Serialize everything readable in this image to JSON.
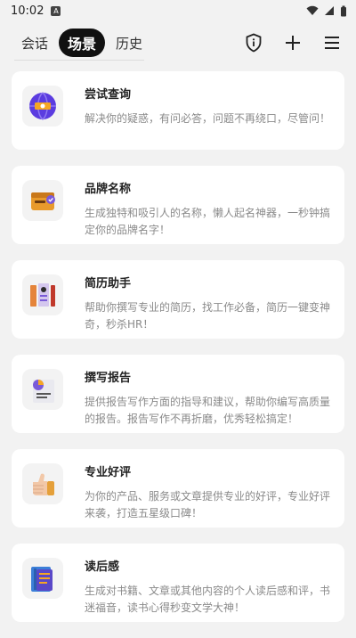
{
  "status": {
    "time": "10:02",
    "notif_letter": "A"
  },
  "tabs": [
    {
      "label": "会话",
      "active": false
    },
    {
      "label": "场景",
      "active": true
    },
    {
      "label": "历史",
      "active": false
    }
  ],
  "header_icons": [
    "shield-info-icon",
    "plus-icon",
    "menu-icon"
  ],
  "cards": [
    {
      "title": "尝试查询",
      "desc": "解决你的疑惑，有问必答，问题不再绕口，尽管问！",
      "icon": "globe-query-icon"
    },
    {
      "title": "品牌名称",
      "desc": "生成独特和吸引人的名称，懒人起名神器，一秒钟搞定你的品牌名字！",
      "icon": "wallet-badge-icon"
    },
    {
      "title": "简历助手",
      "desc": "帮助你撰写专业的简历，找工作必备，简历一键变神奇，秒杀HR！",
      "icon": "resume-card-icon"
    },
    {
      "title": "撰写报告",
      "desc": "提供报告写作方面的指导和建议，帮助你编写高质量的报告。报告写作不再折磨，优秀轻松搞定！",
      "icon": "report-chart-icon"
    },
    {
      "title": "专业好评",
      "desc": "为你的产品、服务或文章提供专业的好评，专业好评来袭，打造五星级口碑！",
      "icon": "thumbs-up-icon"
    },
    {
      "title": "读后感",
      "desc": "生成对书籍、文章或其他内容的个人读后感和评，书迷福音，读书心得秒变文学大神！",
      "icon": "book-notes-icon"
    }
  ]
}
